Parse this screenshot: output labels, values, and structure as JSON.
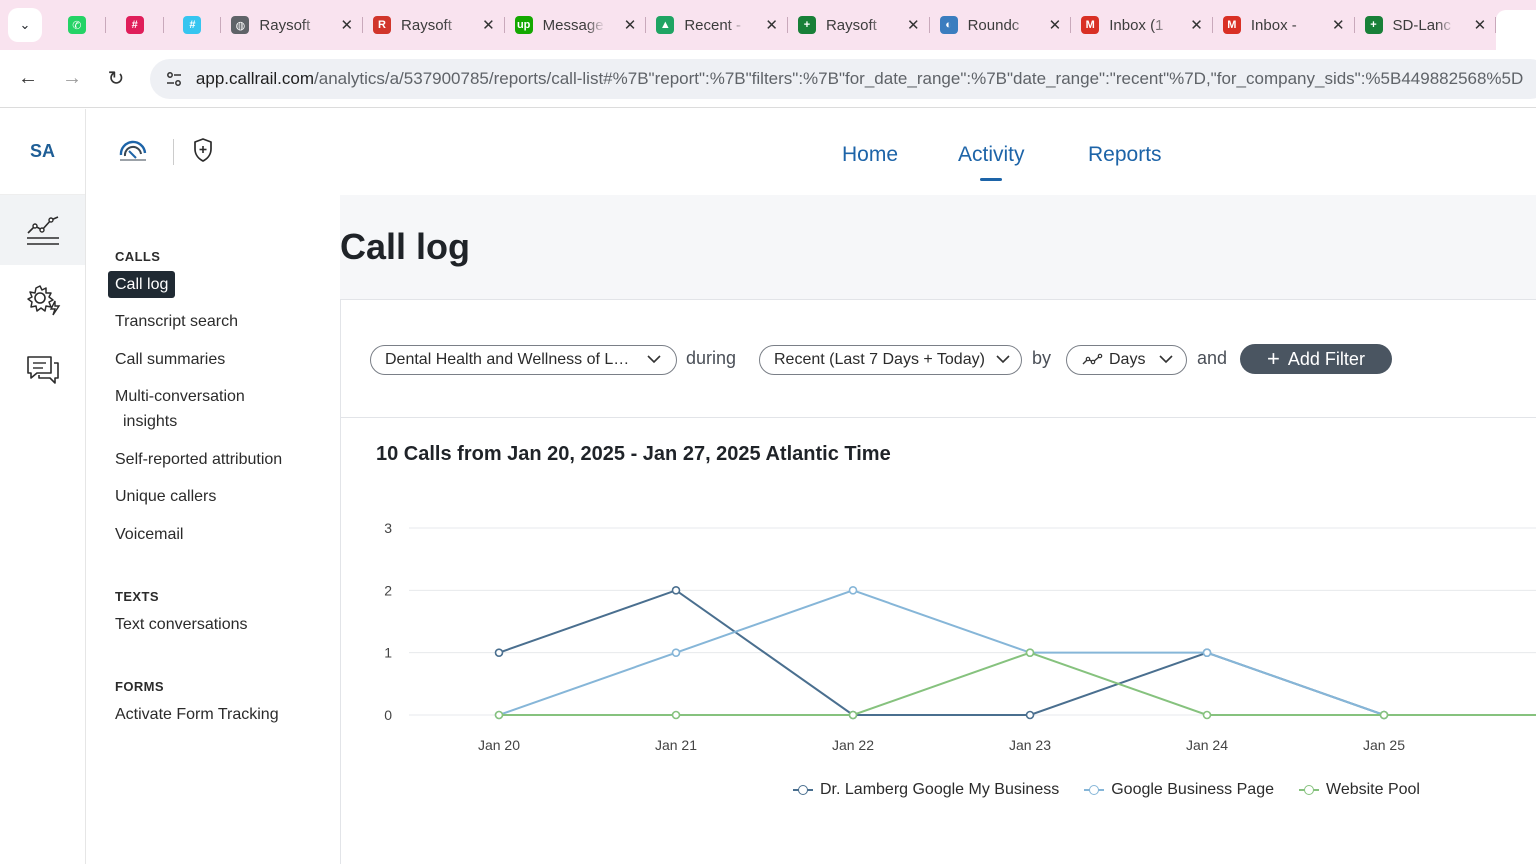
{
  "browser": {
    "tabs": [
      {
        "kind": "pinned",
        "icon": "whatsapp-icon",
        "color": "#25d366",
        "glyph": "✆"
      },
      {
        "kind": "pinned",
        "icon": "slack-icon",
        "color": "#e01e5a",
        "glyph": "#"
      },
      {
        "kind": "pinned",
        "icon": "slack-icon",
        "color": "#36c5f0",
        "glyph": "#"
      },
      {
        "kind": "normal",
        "icon": "globe-icon",
        "color": "#5f6368",
        "glyph": "◍",
        "title": "Raysoft"
      },
      {
        "kind": "normal",
        "icon": "raysoft-icon",
        "color": "#d1352b",
        "glyph": "R",
        "title": "Raysoft"
      },
      {
        "kind": "normal",
        "icon": "upwork-icon",
        "color": "#14a800",
        "glyph": "up",
        "title": "Message"
      },
      {
        "kind": "normal",
        "icon": "google-drive-icon",
        "color": "#1fa463",
        "glyph": "▲",
        "title": "Recent -"
      },
      {
        "kind": "normal",
        "icon": "google-sheets-icon",
        "color": "#188038",
        "glyph": "+",
        "title": "Raysoft"
      },
      {
        "kind": "normal",
        "icon": "roundcube-icon",
        "color": "#3b7dbf",
        "glyph": "◐",
        "title": "Roundc"
      },
      {
        "kind": "normal",
        "icon": "gmail-icon",
        "color": "#d93025",
        "glyph": "M",
        "title": "Inbox (1"
      },
      {
        "kind": "normal",
        "icon": "gmail-icon",
        "color": "#d93025",
        "glyph": "M",
        "title": "Inbox -"
      },
      {
        "kind": "normal",
        "icon": "google-sheets-icon",
        "color": "#188038",
        "glyph": "+",
        "title": "SD-Lanc"
      }
    ],
    "url_host": "app.callrail.com",
    "url_path": "/analytics/a/537900785/reports/call-list#%7B\"report\":%7B\"filters\":%7B\"for_date_range\":%7B\"date_range\":\"recent\"%7D,\"for_company_sids\":%5B449882568%5D"
  },
  "rail": {
    "initials": "SA"
  },
  "nav": {
    "home": "Home",
    "activity": "Activity",
    "reports": "Reports"
  },
  "sidebar": {
    "calls_heading": "CALLS",
    "call_log": "Call log",
    "transcript_search": "Transcript search",
    "call_summaries": "Call summaries",
    "multi_conversation_1": "Multi-conversation",
    "multi_conversation_2": "insights",
    "self_reported": "Self-reported attribution",
    "unique_callers": "Unique callers",
    "voicemail": "Voicemail",
    "texts_heading": "TEXTS",
    "text_conversations": "Text conversations",
    "forms_heading": "FORMS",
    "activate_form": "Activate Form Tracking"
  },
  "page": {
    "title": "Call log"
  },
  "filters": {
    "company": "Dental Health and Wellness of L…",
    "during": "during",
    "date_range": "Recent (Last 7 Days + Today)",
    "by": "by",
    "interval": "Days",
    "and": "and",
    "add_filter": "Add Filter"
  },
  "chart_data": {
    "type": "line",
    "title": "10 Calls from Jan 20, 2025 - Jan 27, 2025 Atlantic Time",
    "categories": [
      "Jan 20",
      "Jan 21",
      "Jan 22",
      "Jan 23",
      "Jan 24",
      "Jan 25"
    ],
    "yticks": [
      0,
      1,
      2,
      3
    ],
    "ylim": [
      0,
      3
    ],
    "grid": true,
    "legend": "bottom",
    "series": [
      {
        "name": "Dr. Lamberg Google My Business",
        "color": "#4a6f8f",
        "values": [
          1,
          2,
          0,
          0,
          1,
          0
        ]
      },
      {
        "name": "Google Business Page",
        "color": "#86b6d8",
        "values": [
          0,
          1,
          2,
          1,
          1,
          0
        ]
      },
      {
        "name": "Website Pool",
        "color": "#86c27e",
        "values": [
          0,
          0,
          0,
          1,
          0,
          0
        ]
      }
    ]
  }
}
